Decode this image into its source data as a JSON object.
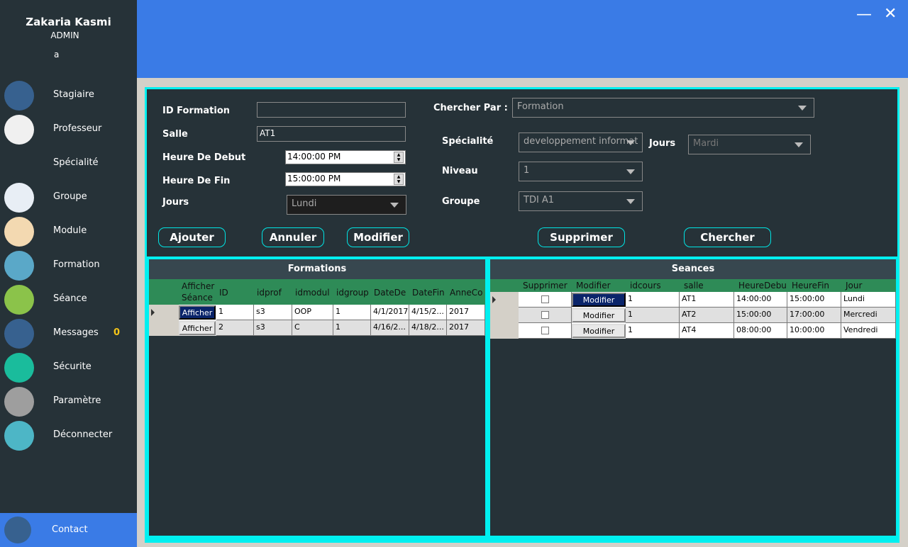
{
  "user": {
    "name": "Zakaria Kasmi",
    "role": "ADMIN",
    "extra": "a"
  },
  "nav": [
    {
      "label": "Stagiaire",
      "icon": "student-icon",
      "color": "#37618f"
    },
    {
      "label": "Professeur",
      "icon": "professor-icon",
      "color": "#f0f0f0"
    },
    {
      "label": "Spécialité",
      "icon": "network-icon",
      "color": "#263238"
    },
    {
      "label": "Groupe",
      "icon": "group-icon",
      "color": "#e8eef5"
    },
    {
      "label": "Module",
      "icon": "puzzle-icon",
      "color": "#f3d9b1"
    },
    {
      "label": "Formation",
      "icon": "book-icon",
      "color": "#5aa8c8"
    },
    {
      "label": "Séance",
      "icon": "teacher-icon",
      "color": "#8bc34a"
    },
    {
      "label": "Messages",
      "icon": "bell-icon",
      "color": "#37618f",
      "badge": "0"
    },
    {
      "label": "Sécurite",
      "icon": "shield-icon",
      "color": "#1abc9c"
    },
    {
      "label": "Paramètre",
      "icon": "gear-icon",
      "color": "#9e9e9e"
    },
    {
      "label": "Déconnecter",
      "icon": "power-icon",
      "color": "#4db6c6"
    }
  ],
  "contact": {
    "label": "Contact"
  },
  "window": {
    "minimize": "—",
    "close": "✕"
  },
  "form": {
    "id_label": "ID Formation",
    "id_value": "",
    "salle_label": "Salle",
    "salle_value": "AT1",
    "debut_label": "Heure De Debut",
    "debut_value": "14:00:00 PM",
    "fin_label": "Heure De Fin",
    "fin_value": "15:00:00 PM",
    "jours_label": "Jours",
    "jours_value": "Lundi",
    "chercher_par_label": "Chercher Par :",
    "chercher_par_value": "Formation",
    "specialite_label": "Spécialité",
    "specialite_value": "developpement informat",
    "jours2_label": "Jours",
    "jours2_value": "Mardi",
    "niveau_label": "Niveau",
    "niveau_value": "1",
    "groupe_label": "Groupe",
    "groupe_value": "TDI A1"
  },
  "buttons": {
    "ajouter": "Ajouter",
    "annuler": "Annuler",
    "modifier": "Modifier",
    "supprimer": "Supprimer",
    "chercher": "Chercher"
  },
  "formations": {
    "title": "Formations",
    "columns": [
      "Afficher Séance",
      "ID",
      "idprof",
      "idmodul",
      "idgroup",
      "DateDe",
      "DateFin",
      "AnneCo"
    ],
    "rows": [
      {
        "btn": "Afficher",
        "id": "1",
        "idprof": "s3",
        "idmodul": "OOP",
        "idgroup": "1",
        "datede": "4/1/2017",
        "datefin": "4/15/2...",
        "anne": "2017"
      },
      {
        "btn": "Afficher",
        "id": "2",
        "idprof": "s3",
        "idmodul": "C",
        "idgroup": "1",
        "datede": "4/16/2...",
        "datefin": "4/18/2...",
        "anne": "2017"
      }
    ]
  },
  "seances": {
    "title": "Seances",
    "columns": [
      "Supprimer",
      "Modifier",
      "idcours",
      "salle",
      "HeureDebu",
      "HeureFin",
      "Jour"
    ],
    "rows": [
      {
        "btn": "Modifier",
        "idcours": "1",
        "salle": "AT1",
        "debut": "14:00:00",
        "fin": "15:00:00",
        "jour": "Lundi"
      },
      {
        "btn": "Modifier",
        "idcours": "1",
        "salle": "AT2",
        "debut": "15:00:00",
        "fin": "17:00:00",
        "jour": "Mercredi"
      },
      {
        "btn": "Modifier",
        "idcours": "1",
        "salle": "AT4",
        "debut": "08:00:00",
        "fin": "10:00:00",
        "jour": "Vendredi"
      }
    ]
  }
}
